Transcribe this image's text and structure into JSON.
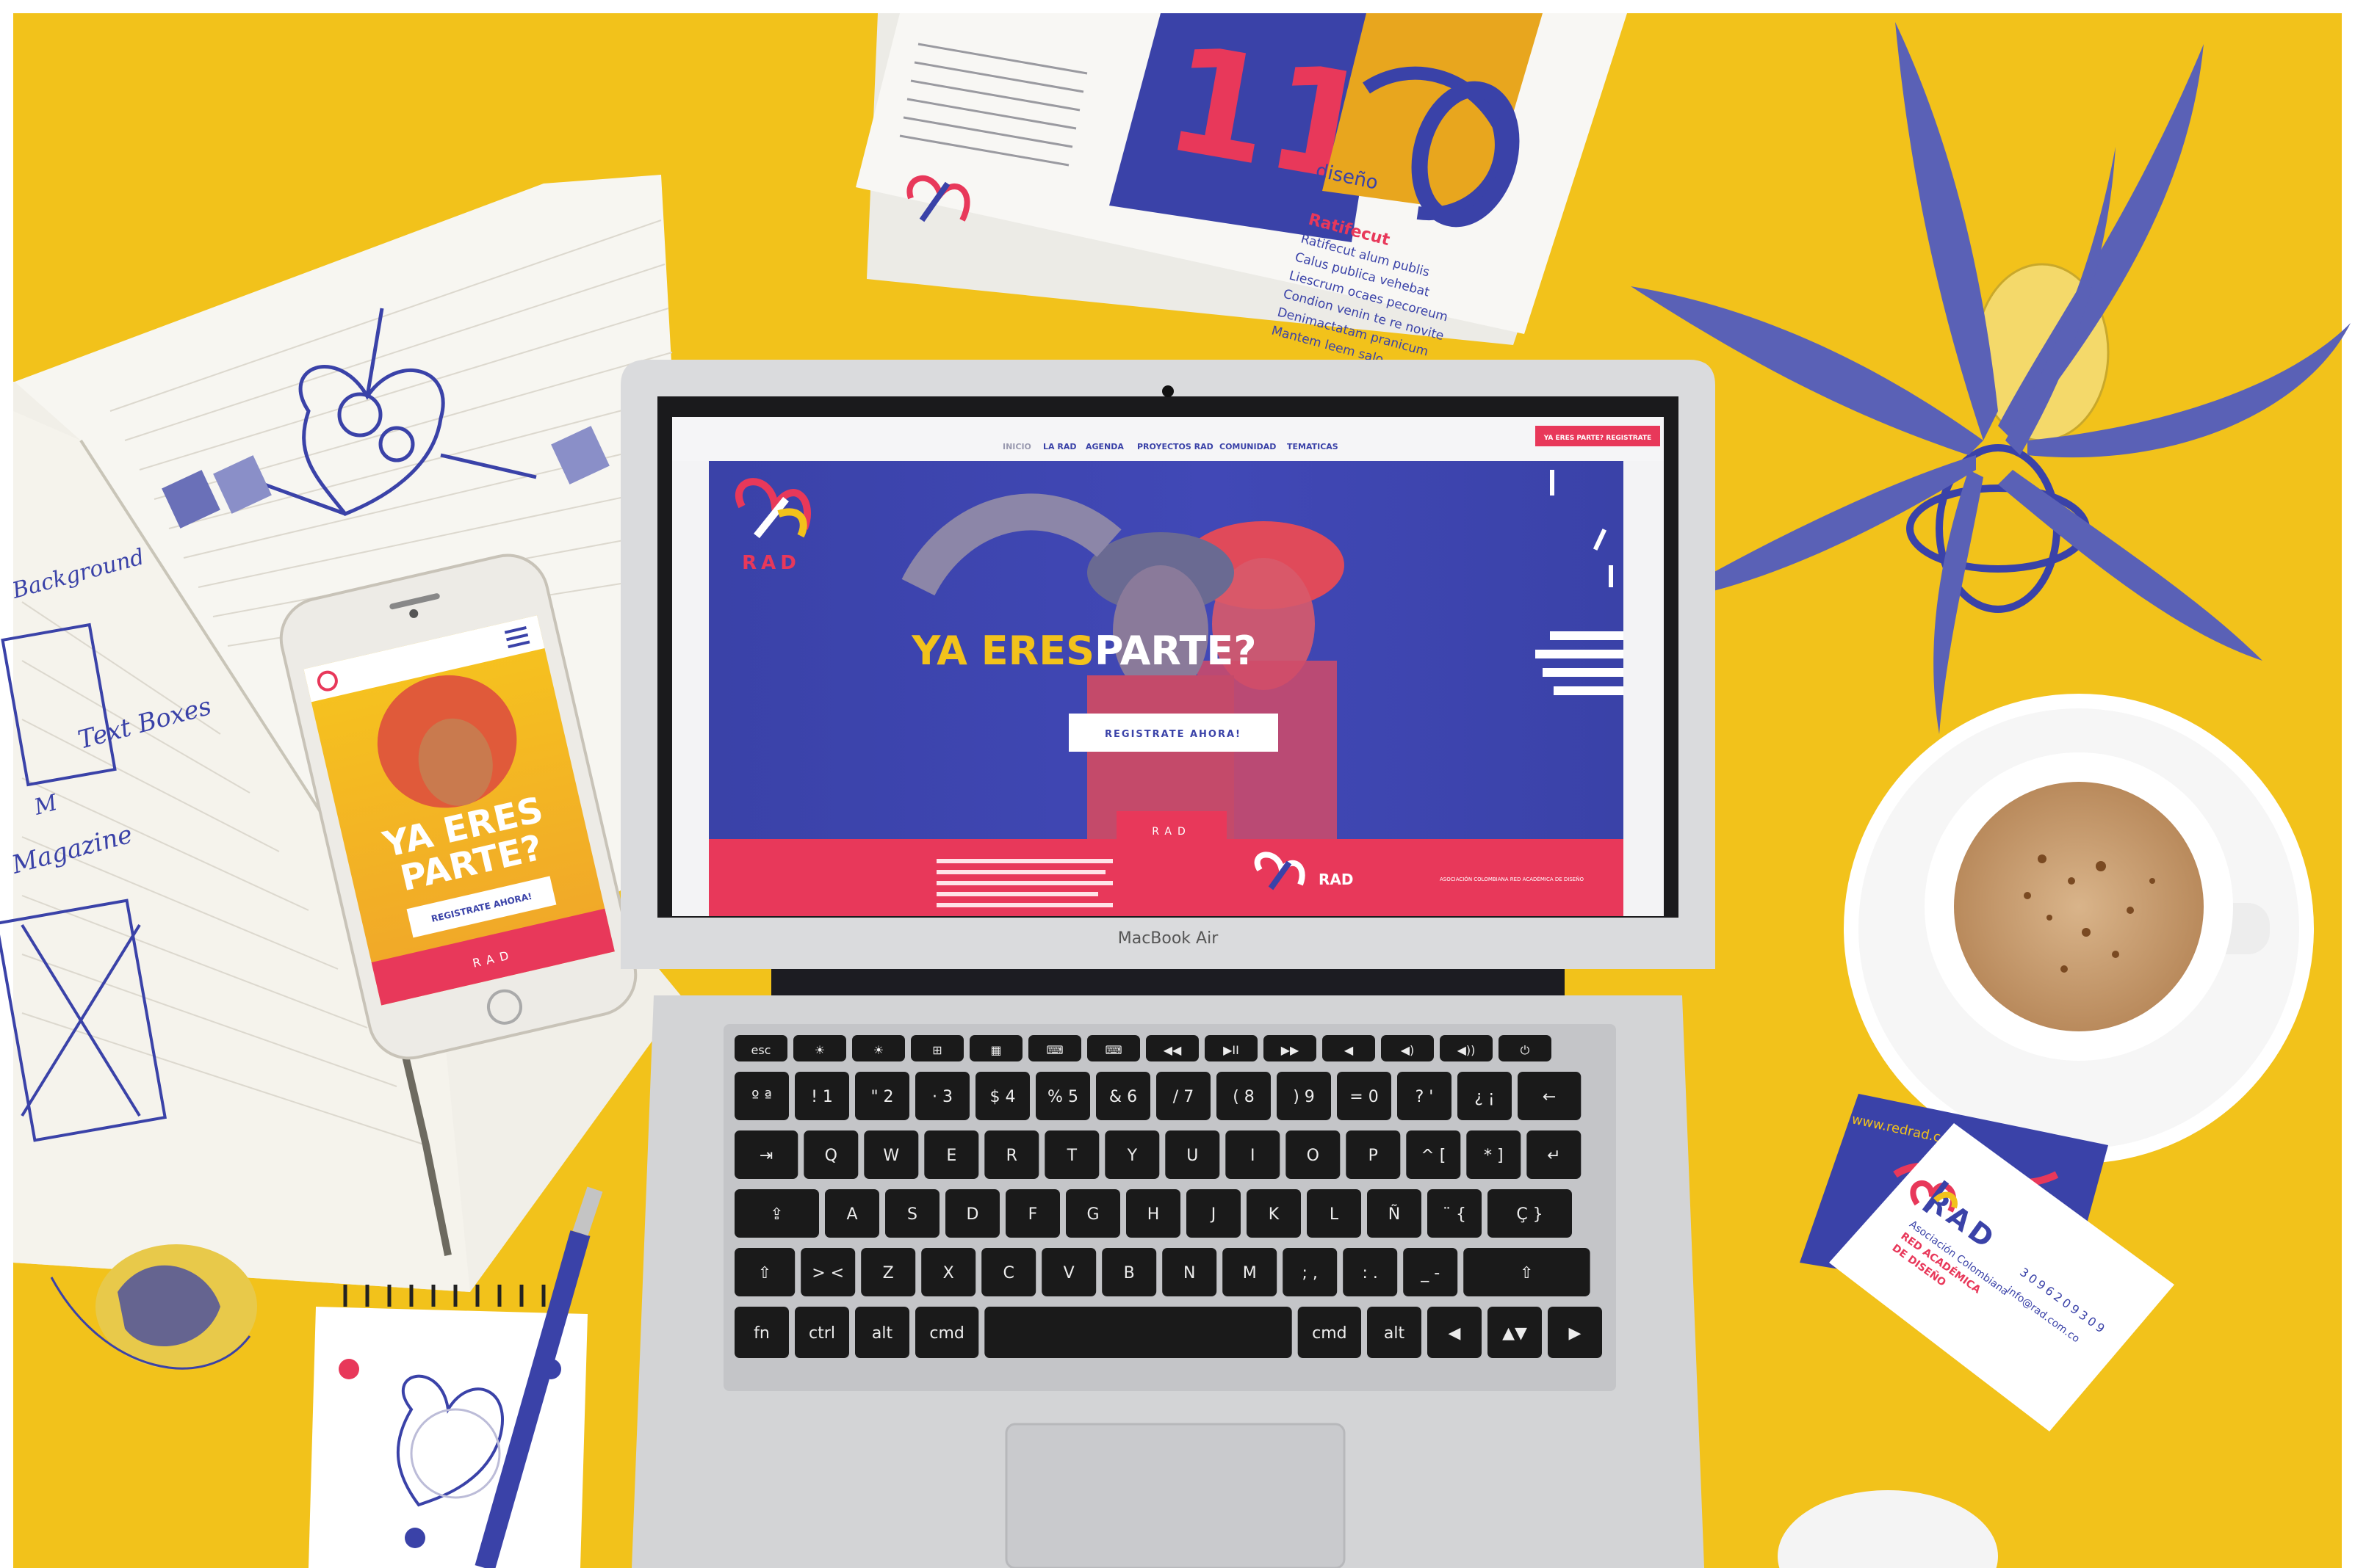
{
  "colors": {
    "desk": "#F2C21B",
    "brand_blue": "#3A42A8",
    "brand_red": "#E8385A",
    "laptop_silver": "#D9DADC",
    "key_black": "#1A1A1A",
    "paper": "#F7F6F1"
  },
  "website": {
    "nav_items": [
      "INICIO",
      "LA RAD",
      "AGENDA",
      "PROYECTOS RAD",
      "COMUNIDAD",
      "TEMATICAS"
    ],
    "top_badge": "YA ERES PARTE? REGISTRATE",
    "logo_text": "RAD",
    "hero_word_1": "YA ERES",
    "hero_word_2": "PARTE?",
    "cta_button": "REGISTRATE AHORA!",
    "footer_tab": "RAD",
    "footer_logo_text": "RAD",
    "footer_tagline": "ASOCIACIÓN COLOMBIANA RED ACADÉMICA DE DISEÑO"
  },
  "laptop": {
    "model_label": "MacBook Air",
    "keyboard": {
      "fn_row": [
        "esc",
        "☀",
        "☀",
        "⊞",
        "▦",
        "⌨",
        "⌨",
        "◀◀",
        "▶II",
        "▶▶",
        "◀",
        "◀)",
        "◀))",
        "⏻"
      ],
      "number_row": [
        "º ª",
        "! 1",
        "\" 2",
        "· 3",
        "$ 4",
        "% 5",
        "& 6",
        "/ 7",
        "( 8",
        ") 9",
        "= 0",
        "? '",
        "¿ ¡",
        "←"
      ],
      "qwerty_row": [
        "⇥",
        "Q",
        "W",
        "E",
        "R",
        "T",
        "Y",
        "U",
        "I",
        "O",
        "P",
        "^ [",
        "* ]",
        "↵"
      ],
      "asdf_row": [
        "⇪",
        "A",
        "S",
        "D",
        "F",
        "G",
        "H",
        "J",
        "K",
        "L",
        "Ñ",
        "¨ {",
        "Ç }"
      ],
      "zxcv_row": [
        "⇧",
        "> <",
        "Z",
        "X",
        "C",
        "V",
        "B",
        "N",
        "M",
        "; ,",
        ": .",
        "_ -",
        "⇧"
      ],
      "bottom_row": [
        "fn",
        "ctrl",
        "alt",
        "cmd",
        "",
        "cmd",
        "alt",
        "◀",
        "▲▼",
        "▶"
      ]
    }
  },
  "phone": {
    "hero_word_1": "YA ERES",
    "hero_word_2": "PARTE?",
    "cta_button": "REGISTRATE AHORA!",
    "footer_tab": "RAD"
  },
  "notebook": {
    "notes": [
      "Background",
      "Text Boxes",
      "M",
      "Magazine"
    ]
  },
  "magazine": {
    "big_number": "11",
    "title_word": "diseño",
    "heading": "Ratifecut",
    "list": [
      "Ratifecut alum publis",
      "Calus publica vehebat",
      "Liescrum ocaes pecoreum",
      "Condion venin te re novite",
      "Denimactatam pranicum",
      "Mantem leem salo"
    ]
  },
  "business_card": {
    "logo_text": "RAD",
    "lines": [
      "Asociación Colombiana",
      "RED ACADÉMICA",
      "DE DISEÑO"
    ],
    "phone": "3096209309",
    "email": "info@rad.com.co",
    "back_url": "www.redrad.com"
  }
}
